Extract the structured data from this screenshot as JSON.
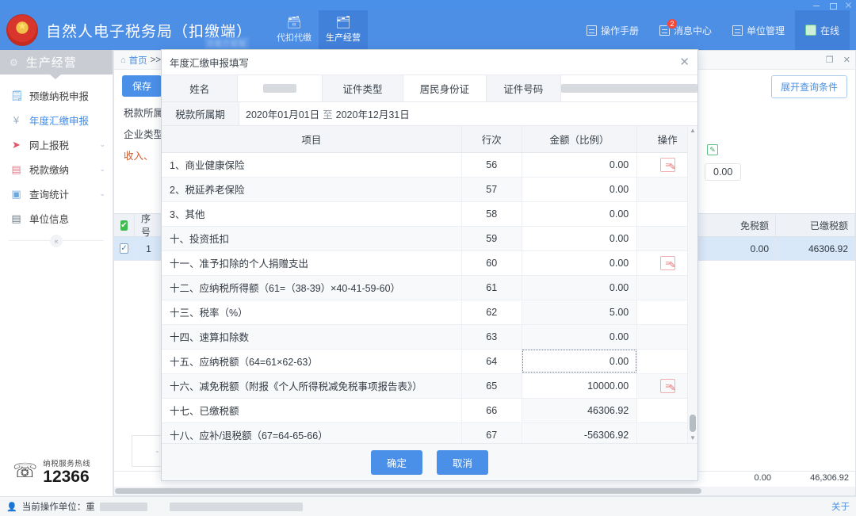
{
  "window": {
    "minimize": "—",
    "maximize": "❐",
    "close": "✕"
  },
  "header": {
    "brand_title": "自然人电子税务局（扣缴端）",
    "brand_sub": "功能介绍版",
    "modes": [
      {
        "label": "代扣代缴",
        "icon": "wallet-icon",
        "glyph": "🗃",
        "active": false
      },
      {
        "label": "生产经营",
        "icon": "stack-icon",
        "glyph": "🗂",
        "active": true
      }
    ],
    "actions": [
      {
        "label": "操作手册",
        "icon": "manual-icon"
      },
      {
        "label": "消息中心",
        "icon": "message-icon",
        "badge": "2"
      },
      {
        "label": "单位管理",
        "icon": "org-icon"
      },
      {
        "label": "在线",
        "icon": "online-icon"
      }
    ]
  },
  "sidebar": {
    "title": "生产经营",
    "gear": "⚙",
    "items": [
      {
        "label": "预缴纳税申报",
        "icon": "clipboard-icon",
        "glyph": "🗒",
        "active": false,
        "chevron": ""
      },
      {
        "label": "年度汇缴申报",
        "icon": "annual-icon",
        "glyph": "¥",
        "active": true,
        "chevron": ""
      },
      {
        "label": "网上报税",
        "icon": "send-icon",
        "glyph": "➤",
        "active": false,
        "chevron": "⌄"
      },
      {
        "label": "税款缴纳",
        "icon": "pay-icon",
        "glyph": "▤",
        "active": false,
        "chevron": "⌄"
      },
      {
        "label": "查询统计",
        "icon": "stats-icon",
        "glyph": "▣",
        "active": false,
        "chevron": "⌄"
      },
      {
        "label": "单位信息",
        "icon": "building-icon",
        "glyph": "▤",
        "active": false,
        "chevron": ""
      }
    ],
    "collapse": "«",
    "hotline_icon": "headset-icon",
    "hotline_label": "纳税服务热线",
    "hotline_number": "12366"
  },
  "background": {
    "breadcrumb_home_icon": "home-icon",
    "breadcrumb_home": "首页",
    "breadcrumb_sep": ">>",
    "win_restore": "❐",
    "win_close": "✕",
    "save_label": "保存",
    "expand_label": "展开查询条件",
    "labels": {
      "period": "税款所属",
      "enterprise_type": "企业类型",
      "income": "收入、"
    },
    "float_value": "0.00",
    "green_edit_icon": "edit-icon",
    "grid": {
      "headers": [
        "",
        "序号",
        "",
        "免税额",
        "已缴税额",
        ""
      ],
      "row": {
        "seq": "1",
        "exempt": "0.00",
        "paid": "46306.92"
      },
      "check_header": "✔",
      "check_row": "✓"
    },
    "totals": {
      "left": "0.00",
      "right": "46,306.92"
    },
    "mini_box": "- —"
  },
  "modal": {
    "title": "年度汇缴申报填写",
    "close_icon": "close-icon",
    "fields": {
      "name_label": "姓名",
      "name_value": "",
      "id_type_label": "证件类型",
      "id_type_value": "居民身份证",
      "id_no_label": "证件号码",
      "id_no_value": "",
      "period_label": "税款所属期",
      "period_start": "2020年01月01日",
      "period_sep": "至",
      "period_end": "2020年12月31日"
    },
    "table": {
      "columns": [
        "项目",
        "行次",
        "金额（比例）",
        "操作"
      ],
      "rows": [
        {
          "item": "1、商业健康保险",
          "line": "56",
          "amount": "0.00",
          "editable": true,
          "action": true,
          "focus": false
        },
        {
          "item": "2、税延养老保险",
          "line": "57",
          "amount": "0.00",
          "editable": true,
          "action": false,
          "focus": false
        },
        {
          "item": "3、其他",
          "line": "58",
          "amount": "0.00",
          "editable": true,
          "action": false,
          "focus": false
        },
        {
          "item": "十、投资抵扣",
          "line": "59",
          "amount": "0.00",
          "editable": true,
          "action": false,
          "focus": false
        },
        {
          "item": "十一、准予扣除的个人捐赠支出",
          "line": "60",
          "amount": "0.00",
          "editable": true,
          "action": true,
          "focus": false
        },
        {
          "item": "十二、应纳税所得额（61=（38-39）×40-41-59-60）",
          "line": "61",
          "amount": "0.00",
          "editable": false,
          "action": false,
          "focus": false
        },
        {
          "item": "十三、税率（%）",
          "line": "62",
          "amount": "5.00",
          "editable": false,
          "action": false,
          "focus": false
        },
        {
          "item": "十四、速算扣除数",
          "line": "63",
          "amount": "0.00",
          "editable": false,
          "action": false,
          "focus": false
        },
        {
          "item": "十五、应纳税额（64=61×62-63）",
          "line": "64",
          "amount": "0.00",
          "editable": true,
          "action": false,
          "focus": true
        },
        {
          "item": "十六、减免税额（附报《个人所得税减免税事项报告表》）",
          "line": "65",
          "amount": "10000.00",
          "editable": true,
          "action": true,
          "focus": false
        },
        {
          "item": "十七、已缴税额",
          "line": "66",
          "amount": "46306.92",
          "editable": false,
          "action": false,
          "focus": false
        },
        {
          "item": "十八、应补/退税额（67=64-65-66）",
          "line": "67",
          "amount": "-56306.92",
          "editable": false,
          "action": false,
          "focus": false
        }
      ],
      "edit_icon": "edit-row-icon",
      "scroll_up": "▲",
      "scroll_down": "▼"
    },
    "confirm_label": "确定",
    "cancel_label": "取消"
  },
  "statusbar": {
    "user_icon": "user-icon",
    "label": "当前操作单位：重",
    "about": "关于"
  },
  "colors": {
    "brand_blue": "#4e8fe6",
    "accent_blue": "#4a90e8",
    "badge_red": "#f5483a",
    "link_blue": "#4a8fe0",
    "check_green": "#3fbb51",
    "edit_pink": "#e98b8b"
  }
}
